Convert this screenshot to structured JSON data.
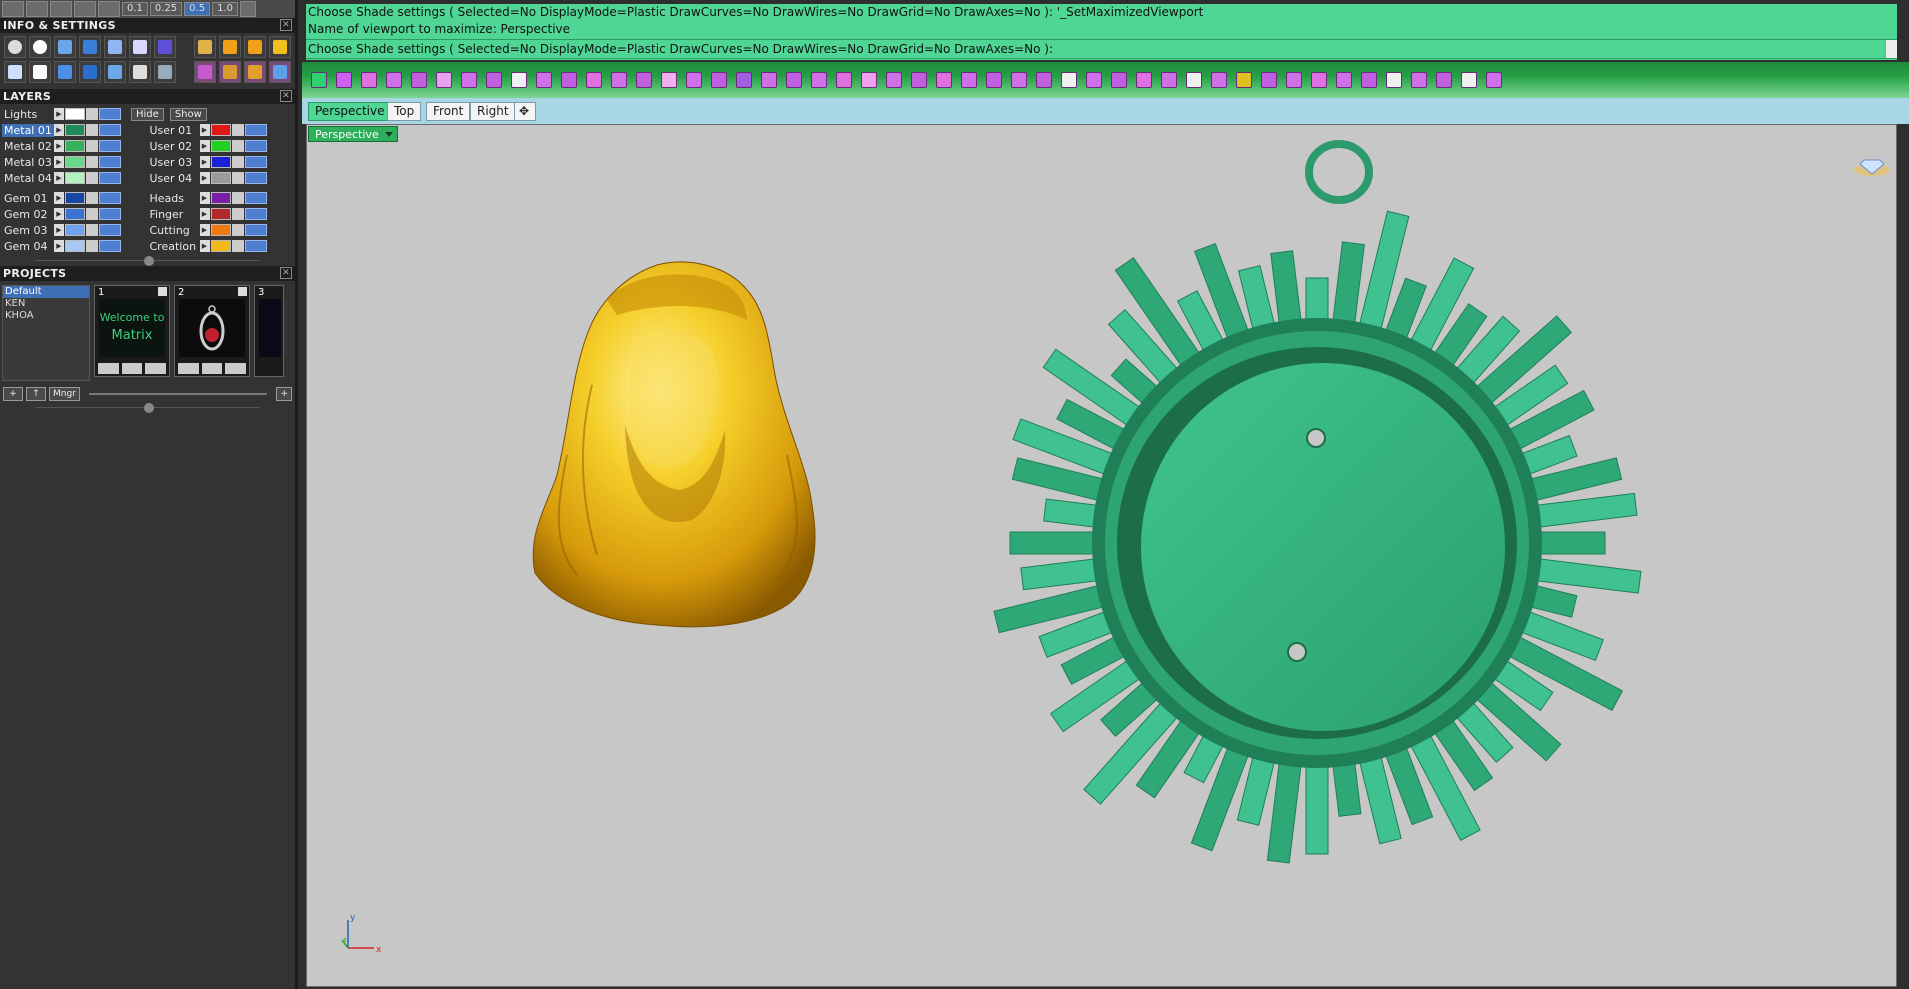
{
  "topstrip": {
    "values": [
      "0.1",
      "0.25",
      "0.5",
      "1.0"
    ],
    "selected_index": 2
  },
  "info_panel": {
    "title": "INFO & SETTINGS"
  },
  "layers_panel": {
    "title": "LAYERS",
    "lights_label": "Lights",
    "hide_label": "Hide",
    "show_label": "Show",
    "left": [
      {
        "name": "Metal 01",
        "color": "#1f8a5a",
        "selected": true
      },
      {
        "name": "Metal 02",
        "color": "#36b05a"
      },
      {
        "name": "Metal 03",
        "color": "#6ad88a"
      },
      {
        "name": "Metal 04",
        "color": "#b3f2c0"
      },
      {
        "name": "Gem 01",
        "color": "#1746a8"
      },
      {
        "name": "Gem 02",
        "color": "#3a72d8"
      },
      {
        "name": "Gem 03",
        "color": "#6ea2ee"
      },
      {
        "name": "Gem 04",
        "color": "#a8c8f4"
      }
    ],
    "right": [
      {
        "name": "User 01",
        "color": "#e01818"
      },
      {
        "name": "User 02",
        "color": "#22d022"
      },
      {
        "name": "User 03",
        "color": "#1820d8"
      },
      {
        "name": "User 04",
        "color": "#9a9a9a"
      },
      {
        "name": "Heads",
        "color": "#7a1fa8"
      },
      {
        "name": "Finger",
        "color": "#b02a2a"
      },
      {
        "name": "Cutting",
        "color": "#f07a10"
      },
      {
        "name": "Creation",
        "color": "#f0b818"
      }
    ]
  },
  "projects_panel": {
    "title": "PROJECTS",
    "items": [
      "Default",
      "KEN",
      "KHOA"
    ],
    "selected": "Default",
    "thumbs": [
      {
        "num": "1",
        "caption": "Welcome to Matrix"
      },
      {
        "num": "2",
        "caption": ""
      },
      {
        "num": "3",
        "caption": ""
      }
    ],
    "mngr_label": "Mngr"
  },
  "command": {
    "line1": "Choose Shade settings ( Selected=No  DisplayMode=Plastic  DrawCurves=No  DrawWires=No  DrawGrid=No  DrawAxes=No ): '_SetMaximizedViewport",
    "line2": "Name of viewport to maximize: Perspective",
    "prompt": "Choose Shade settings ( Selected=No  DisplayMode=Plastic  DrawCurves=No  DrawWires=No  DrawGrid=No  DrawAxes=No ):"
  },
  "viewport_tabs": [
    "Perspective",
    "Top",
    "Front",
    "Right"
  ],
  "active_tab": "Perspective",
  "viewport_label": "Perspective",
  "gizmo": {
    "x": "x",
    "y": "y",
    "z": "z"
  },
  "colors": {
    "command_bg": "#4fd694",
    "toolbar_green": "#25a046",
    "viewport_bg": "#c7c7c7",
    "gold": "#f0c21a",
    "pendant_green": "#35b886"
  }
}
